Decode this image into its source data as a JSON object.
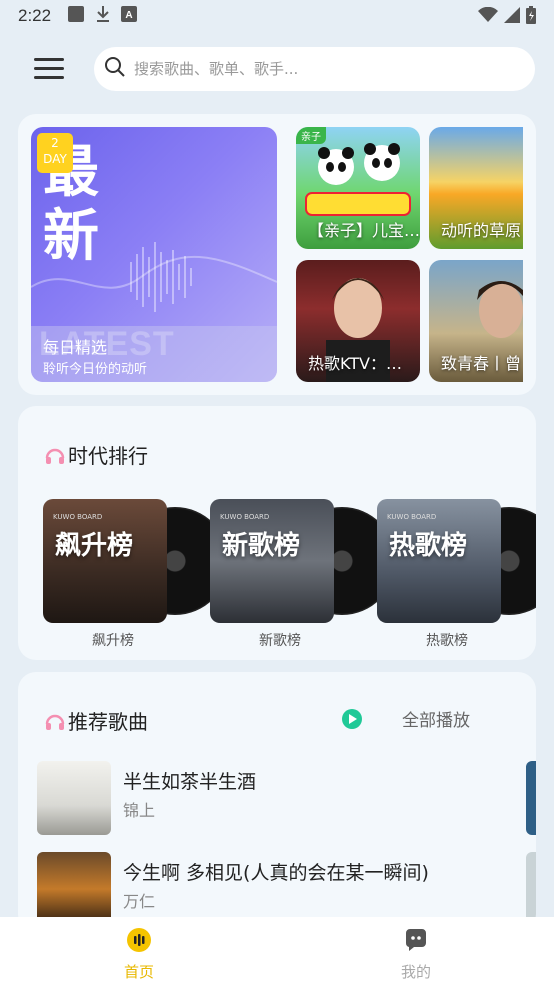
{
  "status_bar": {
    "time": "2:22",
    "icons": [
      "photo-icon",
      "download-icon",
      "a-icon",
      "wifi-icon",
      "signal-icon",
      "battery-icon"
    ]
  },
  "header": {
    "search_placeholder": "搜索歌曲、歌单、歌手..."
  },
  "featured": {
    "big_chars": [
      "最",
      "新"
    ],
    "badge_number": "2",
    "badge_unit": "DAY",
    "bg_word": "LATEST",
    "title": "每日精选",
    "subtitle": "聆听今日份的动听"
  },
  "tiles": [
    {
      "label": "【亲子】儿宝…",
      "tag": "亲子"
    },
    {
      "label": "动听的草原"
    },
    {
      "label": "热歌KTV：…"
    },
    {
      "label": "致青春丨曾"
    }
  ],
  "rankings": {
    "title": "时代排行",
    "brand": "KUWO BOARD",
    "items": [
      {
        "cover_text": "飙升榜",
        "label": "飙升榜"
      },
      {
        "cover_text": "新歌榜",
        "label": "新歌榜"
      },
      {
        "cover_text": "热歌榜",
        "label": "热歌榜"
      }
    ]
  },
  "recommended": {
    "title": "推荐歌曲",
    "play_all": "全部播放",
    "songs": [
      {
        "title": "半生如茶半生酒",
        "artist": "锦上"
      },
      {
        "title": "今生啊 多相见(人真的会在某一瞬间)",
        "artist": "万仁"
      }
    ]
  },
  "bottom_nav": {
    "home": "首页",
    "mine": "我的"
  },
  "colors": {
    "accent": "#e8b800",
    "play_green": "#20c997",
    "background": "#e6eef5"
  }
}
